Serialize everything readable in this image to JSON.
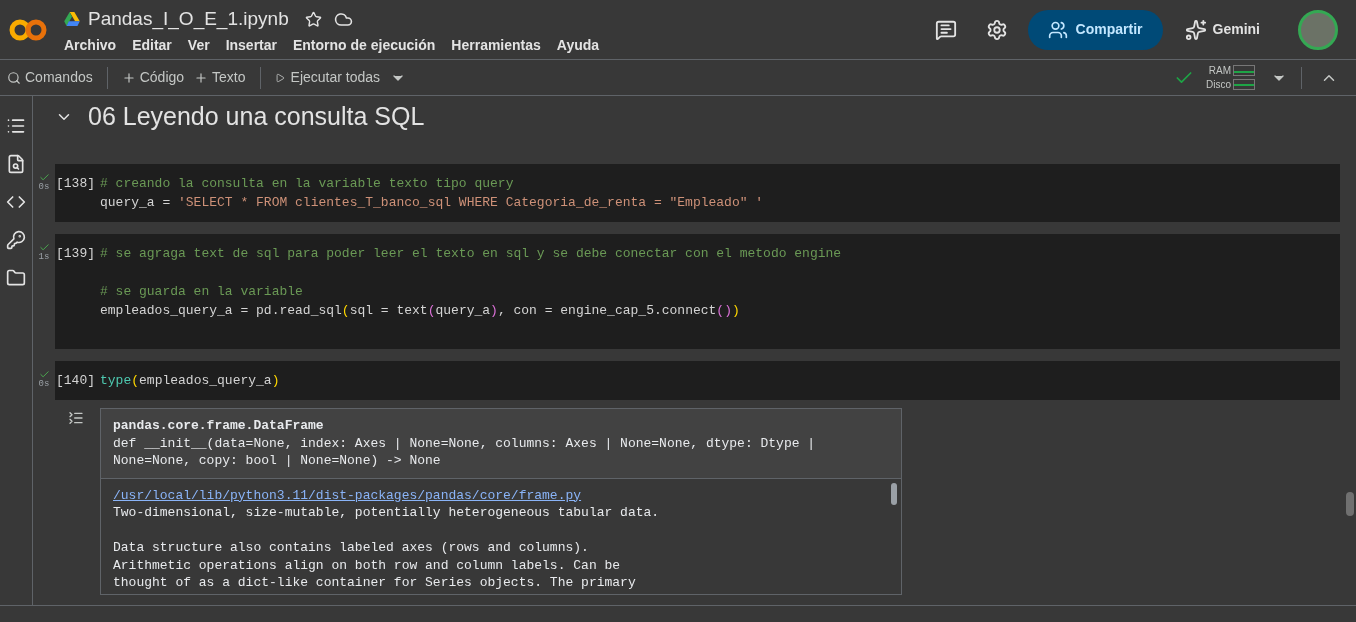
{
  "header": {
    "file_name": "Pandas_I_O_E_1.ipynb",
    "menu": [
      "Archivo",
      "Editar",
      "Ver",
      "Insertar",
      "Entorno de ejecución",
      "Herramientas",
      "Ayuda"
    ],
    "share_label": "Compartir",
    "gemini_label": "Gemini"
  },
  "toolbar": {
    "commands": "Comandos",
    "add_code": "Código",
    "add_text": "Texto",
    "run_all": "Ejecutar todas",
    "ram_label": "RAM",
    "disk_label": "Disco",
    "connected": true
  },
  "section": {
    "title": "06 Leyendo una consulta SQL",
    "expanded": true
  },
  "cells": [
    {
      "prompt": "[138]",
      "duration": "0s",
      "success": true,
      "lines": [
        {
          "gap_after": false,
          "tokens": [
            {
              "kind": "comment",
              "text": "# creando la consulta en la variable texto tipo query"
            }
          ]
        },
        {
          "gap_after": false,
          "tokens": [
            {
              "kind": "plain",
              "text": "query_a = "
            },
            {
              "kind": "string",
              "text": "'SELECT * FROM clientes_T_banco_sql WHERE Categoria_de_renta = \"Empleado\" '"
            }
          ]
        }
      ]
    },
    {
      "prompt": "[139]",
      "duration": "1s",
      "success": true,
      "lines": [
        {
          "gap_after": true,
          "tokens": [
            {
              "kind": "comment",
              "text": "# se agraga text de sql para poder leer el texto en sql y se debe conectar con el metodo engine"
            }
          ]
        },
        {
          "gap_after": false,
          "tokens": [
            {
              "kind": "comment",
              "text": "# se guarda en la variable"
            }
          ]
        },
        {
          "gap_after": true,
          "tokens": [
            {
              "kind": "plain",
              "text": "empleados_query_a = pd.read_sql"
            },
            {
              "kind": "bracket1",
              "text": "("
            },
            {
              "kind": "plain",
              "text": "sql = text"
            },
            {
              "kind": "bracket2",
              "text": "("
            },
            {
              "kind": "plain",
              "text": "query_a"
            },
            {
              "kind": "bracket2",
              "text": ")"
            },
            {
              "kind": "plain",
              "text": ", con = engine_cap_5.connect"
            },
            {
              "kind": "bracket2",
              "text": "()"
            },
            {
              "kind": "bracket1",
              "text": ")"
            }
          ]
        }
      ]
    },
    {
      "prompt": "[140]",
      "duration": "0s",
      "success": true,
      "lines": [
        {
          "gap_after": false,
          "tokens": [
            {
              "kind": "builtin",
              "text": "type"
            },
            {
              "kind": "bracket1",
              "text": "("
            },
            {
              "kind": "plain",
              "text": "empleados_query_a"
            },
            {
              "kind": "bracket1",
              "text": ")"
            }
          ]
        }
      ],
      "output": {
        "title": "pandas.core.frame.DataFrame",
        "signature": "def __init__(data=None, index: Axes | None=None, columns: Axes | None=None, dtype: Dtype | None=None, copy: bool | None=None) -> None",
        "source_link": "/usr/local/lib/python3.11/dist-packages/pandas/core/frame.py",
        "doc_paragraphs": [
          [
            "Two-dimensional, size-mutable, potentially heterogeneous tabular data."
          ],
          [
            "Data structure also contains labeled axes (rows and columns).",
            "Arithmetic operations align on both row and column labels. Can be",
            "thought of as a dict-like container for Series objects. The primary"
          ]
        ]
      }
    }
  ]
}
